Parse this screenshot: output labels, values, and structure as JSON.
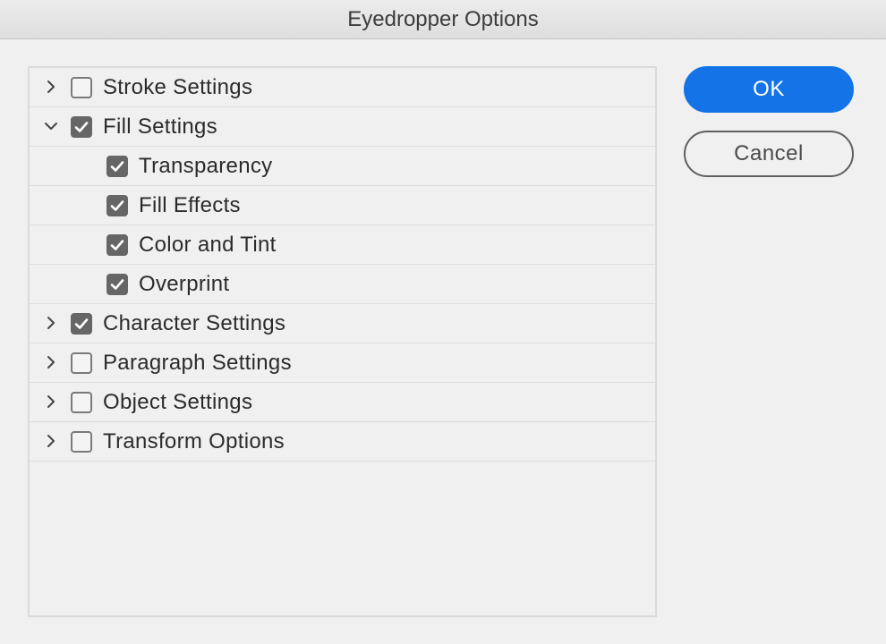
{
  "window": {
    "title": "Eyedropper Options"
  },
  "tree": {
    "items": [
      {
        "label": "Stroke Settings",
        "checked": false,
        "expander": "collapsed",
        "level": 0
      },
      {
        "label": "Fill Settings",
        "checked": true,
        "expander": "expanded",
        "level": 0
      },
      {
        "label": "Transparency",
        "checked": true,
        "expander": "none",
        "level": 1
      },
      {
        "label": "Fill Effects",
        "checked": true,
        "expander": "none",
        "level": 1
      },
      {
        "label": "Color and Tint",
        "checked": true,
        "expander": "none",
        "level": 1
      },
      {
        "label": "Overprint",
        "checked": true,
        "expander": "none",
        "level": 1
      },
      {
        "label": "Character Settings",
        "checked": true,
        "expander": "collapsed",
        "level": 0
      },
      {
        "label": "Paragraph Settings",
        "checked": false,
        "expander": "collapsed",
        "level": 0
      },
      {
        "label": "Object Settings",
        "checked": false,
        "expander": "collapsed",
        "level": 0
      },
      {
        "label": "Transform Options",
        "checked": false,
        "expander": "collapsed",
        "level": 0
      }
    ]
  },
  "buttons": {
    "ok_label": "OK",
    "cancel_label": "Cancel"
  },
  "colors": {
    "accent": "#1473e6",
    "checkbox_fill": "#666666"
  }
}
